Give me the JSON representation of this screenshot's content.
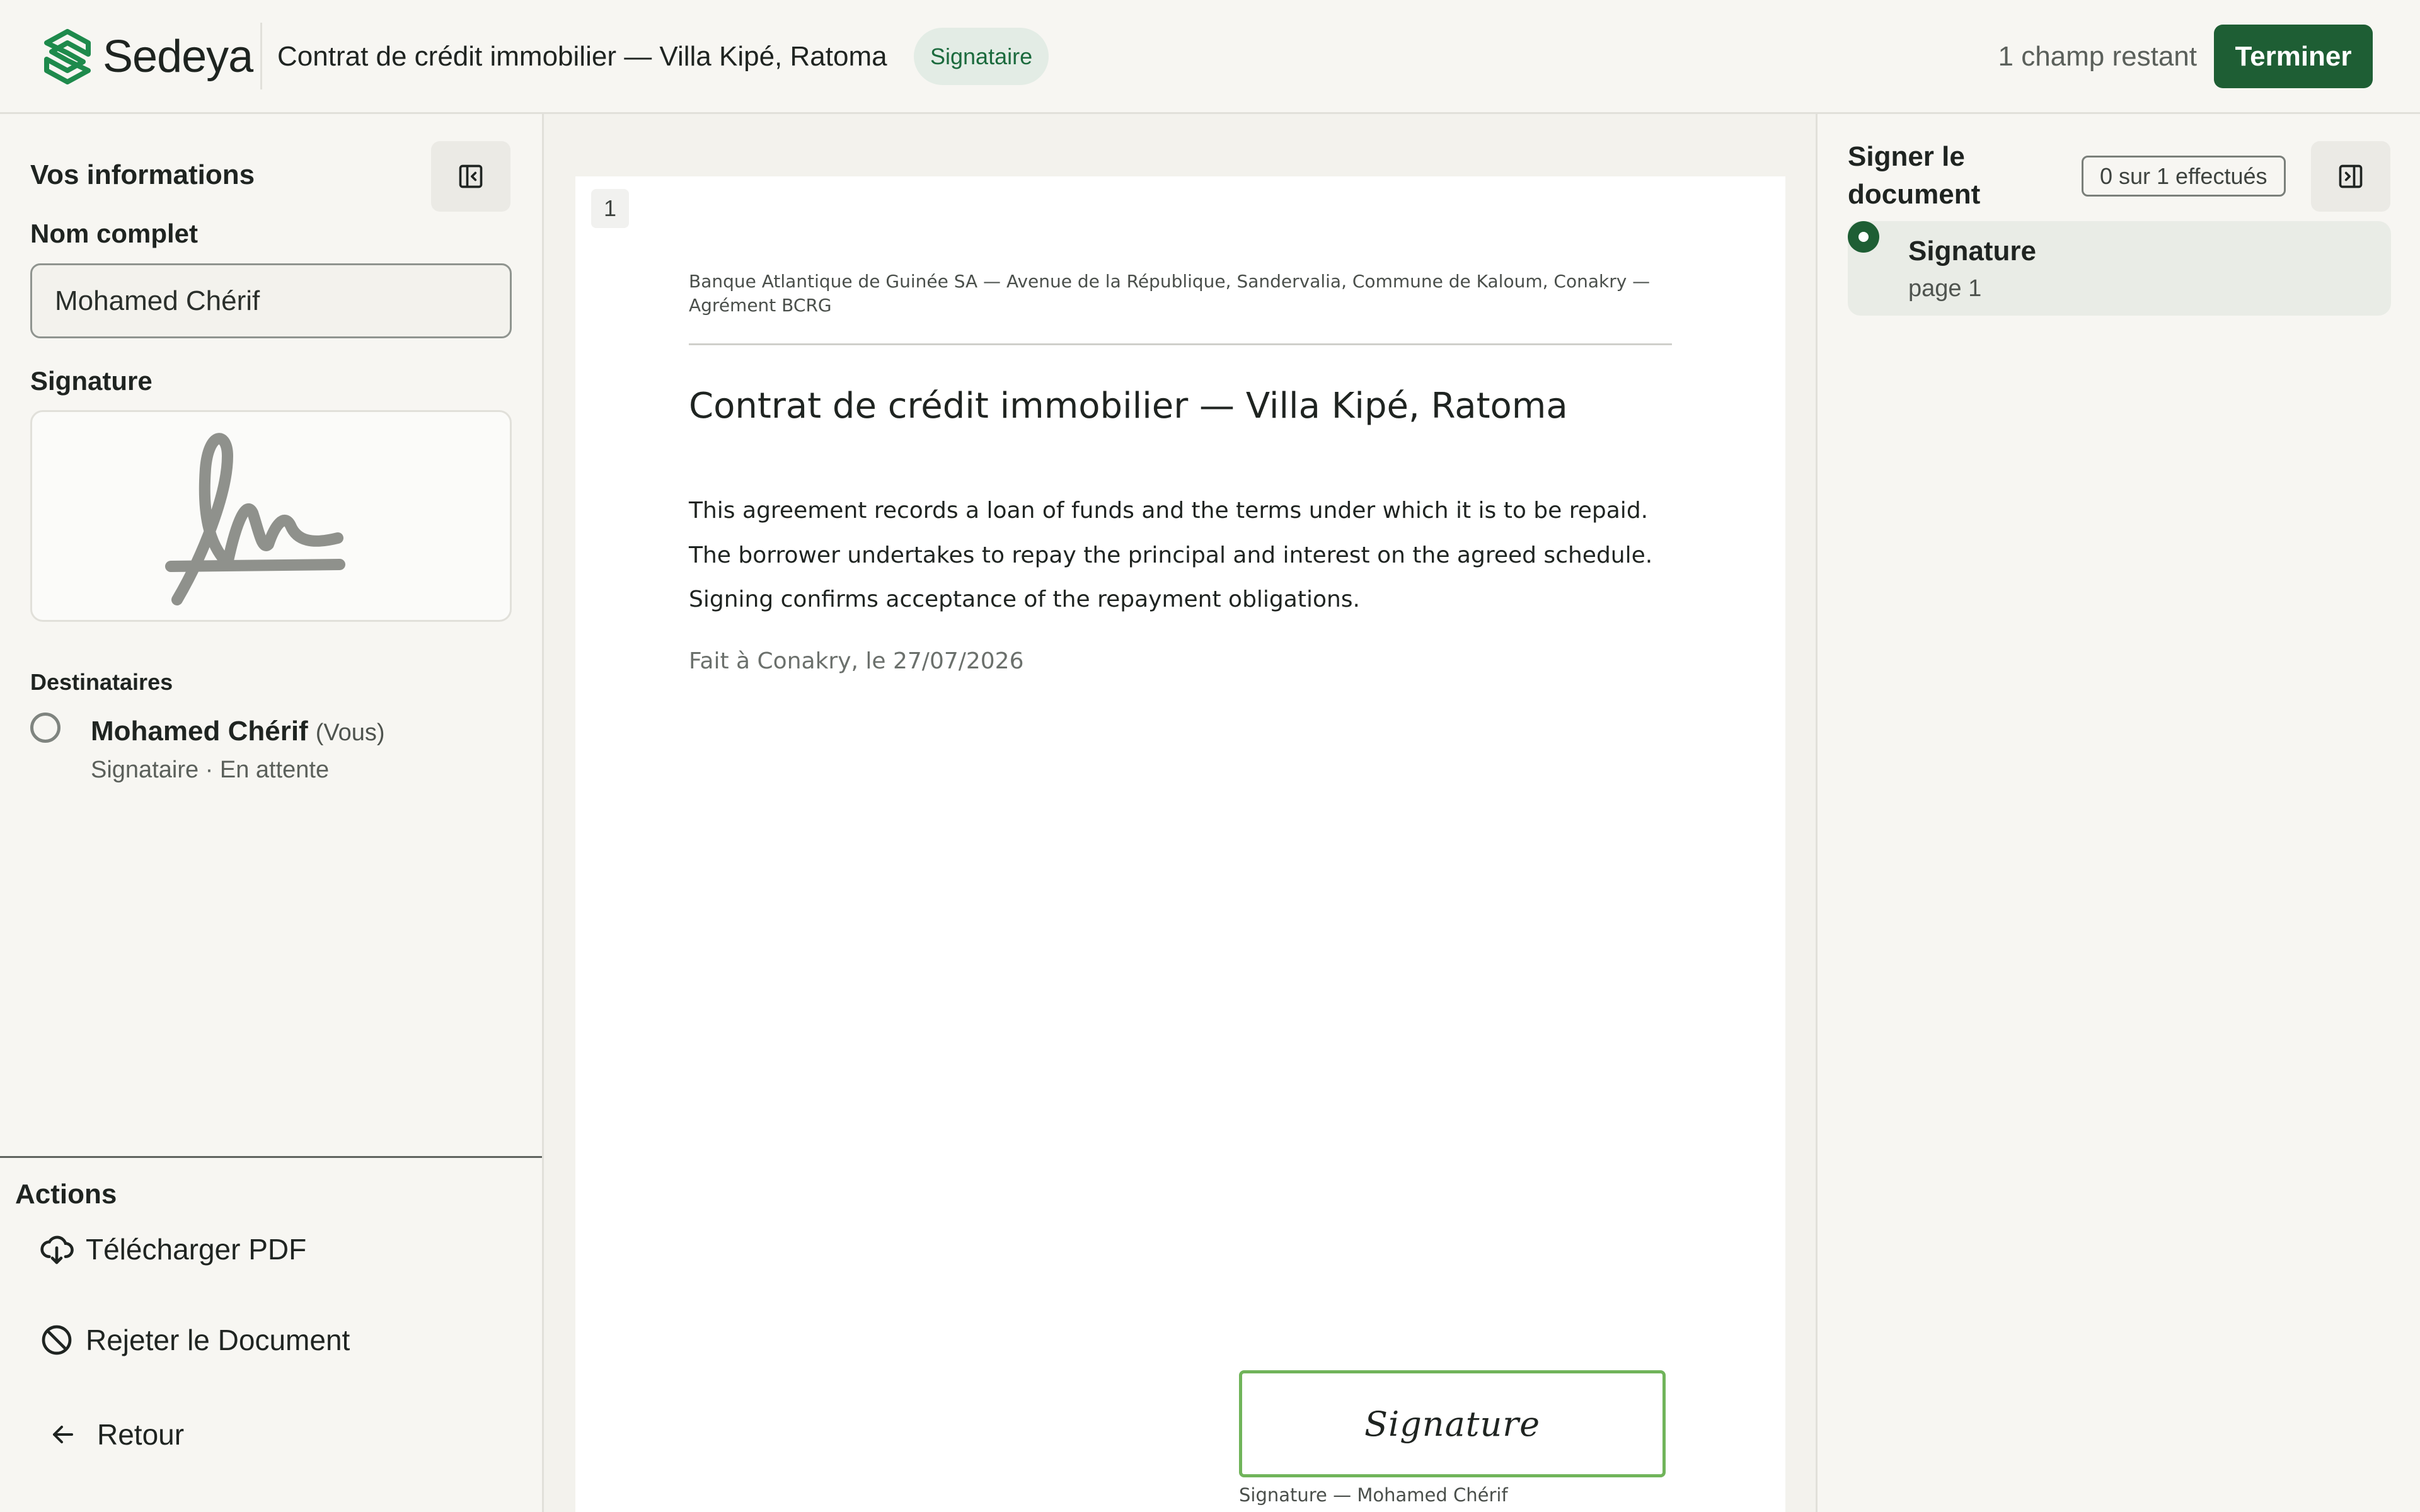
{
  "header": {
    "brand": "Sedeya",
    "document_title": "Contrat de crédit immobilier — Villa Kipé, Ratoma",
    "role_badge": "Signataire",
    "remaining": "1 champ restant",
    "finish_label": "Terminer"
  },
  "left_panel": {
    "heading": "Vos informations",
    "name_label": "Nom complet",
    "name_value": "Mohamed Chérif",
    "signature_label": "Signature",
    "recipients_heading": "Destinataires",
    "recipient": {
      "name": "Mohamed Chérif",
      "you_tag": "(Vous)",
      "status": "Signataire · En attente"
    },
    "actions_heading": "Actions",
    "actions": {
      "download": "Télécharger PDF",
      "reject": "Rejeter le Document",
      "back": "Retour"
    }
  },
  "document": {
    "page_number": "1",
    "bank_line": "Banque Atlantique de Guinée SA — Avenue de la République, Sandervalia, Commune de Kaloum, Conakry — Agrément BCRG",
    "title": "Contrat de crédit immobilier — Villa Kipé, Ratoma",
    "body": [
      "This agreement records a loan of funds and the terms under which it is to be repaid.",
      "The borrower undertakes to repay the principal and interest on the agreed schedule.",
      "Signing confirms acceptance of the repayment obligations."
    ],
    "place_date": "Fait à Conakry, le 27/07/2026",
    "signature_field_label": "Signature",
    "signature_caption": "Signature — Mohamed Chérif"
  },
  "right_panel": {
    "heading": "Signer le document",
    "progress": "0 sur 1 effectués",
    "field": {
      "title": "Signature",
      "page": "page 1"
    }
  },
  "colors": {
    "brand_green": "#1e5e34",
    "badge_bg": "#e3ece5",
    "signature_field_border": "#70b45a"
  },
  "icons": [
    "sedeya-logo-icon",
    "collapse-left-panel-icon",
    "expand-right-panel-icon",
    "download-cloud-icon",
    "ban-icon",
    "arrow-left-icon"
  ]
}
